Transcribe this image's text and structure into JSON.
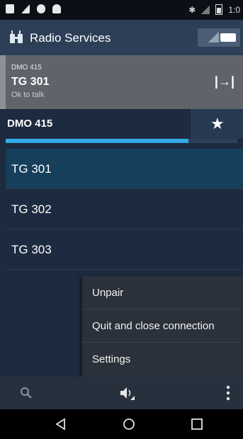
{
  "status_bar": {
    "time": "1:0",
    "icons": [
      "notification-icon",
      "signal-icon",
      "shield-icon",
      "android-icon",
      "bluetooth-icon",
      "no-signal-icon",
      "battery-icon"
    ]
  },
  "app_bar": {
    "title": "Radio Services"
  },
  "connection": {
    "radio": "DMO 415",
    "talkgroup": "TG 301",
    "status": "Ok to talk",
    "disconnect_symbol": "|→|"
  },
  "channel": {
    "label": "DMO 415",
    "star_symbol": "★",
    "progress": 0.79
  },
  "talkgroups": [
    {
      "label": "TG 301",
      "selected": true
    },
    {
      "label": "TG 302",
      "selected": false
    },
    {
      "label": "TG 303",
      "selected": false
    }
  ],
  "menu": {
    "items": [
      "Unpair",
      "Quit and close connection",
      "Settings"
    ]
  },
  "toolbar": {
    "icons": [
      "search-icon",
      "speaker-icon",
      "more-vert-icon"
    ]
  },
  "navbar": {
    "icons": [
      "back-icon",
      "home-icon",
      "recents-icon"
    ]
  },
  "colors": {
    "background": "#1c2b3f",
    "app_bar": "#2c3f57",
    "selected_row": "#163f5c",
    "progress": "#33a9e6",
    "menu": "#2b313a"
  }
}
